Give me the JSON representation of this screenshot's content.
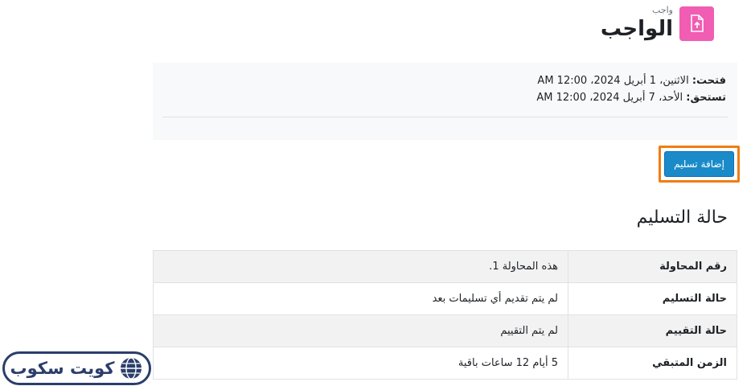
{
  "header": {
    "activity_type": "واجب",
    "title": "الواجب",
    "icon": "assignment-upload-icon",
    "icon_color": "#f05db2"
  },
  "dates": {
    "opened_label": "فتحت:",
    "opened_value": "الاثنين، 1 أبريل 2024، 12:00 AM",
    "due_label": "تستحق:",
    "due_value": "الأحد، 7 أبريل 2024، 12:00 AM"
  },
  "actions": {
    "add_submission_label": "إضافة تسليم",
    "accent_color": "#1a8bc8",
    "highlight_color": "#f07d12"
  },
  "submission_status": {
    "heading": "حالة التسليم",
    "rows": [
      {
        "label": "رقم المحاولة",
        "value": "هذه المحاولة 1."
      },
      {
        "label": "حالة التسليم",
        "value": "لم يتم تقديم أي تسليمات بعد"
      },
      {
        "label": "حالة التقييم",
        "value": "لم يتم التقييم"
      },
      {
        "label": "الزمن المتبقي",
        "value": "5 أيام 12 ساعات باقية"
      }
    ]
  },
  "watermark": {
    "text": "كويت سكوب",
    "icon": "globe-icon",
    "color": "#2b3e6b"
  }
}
